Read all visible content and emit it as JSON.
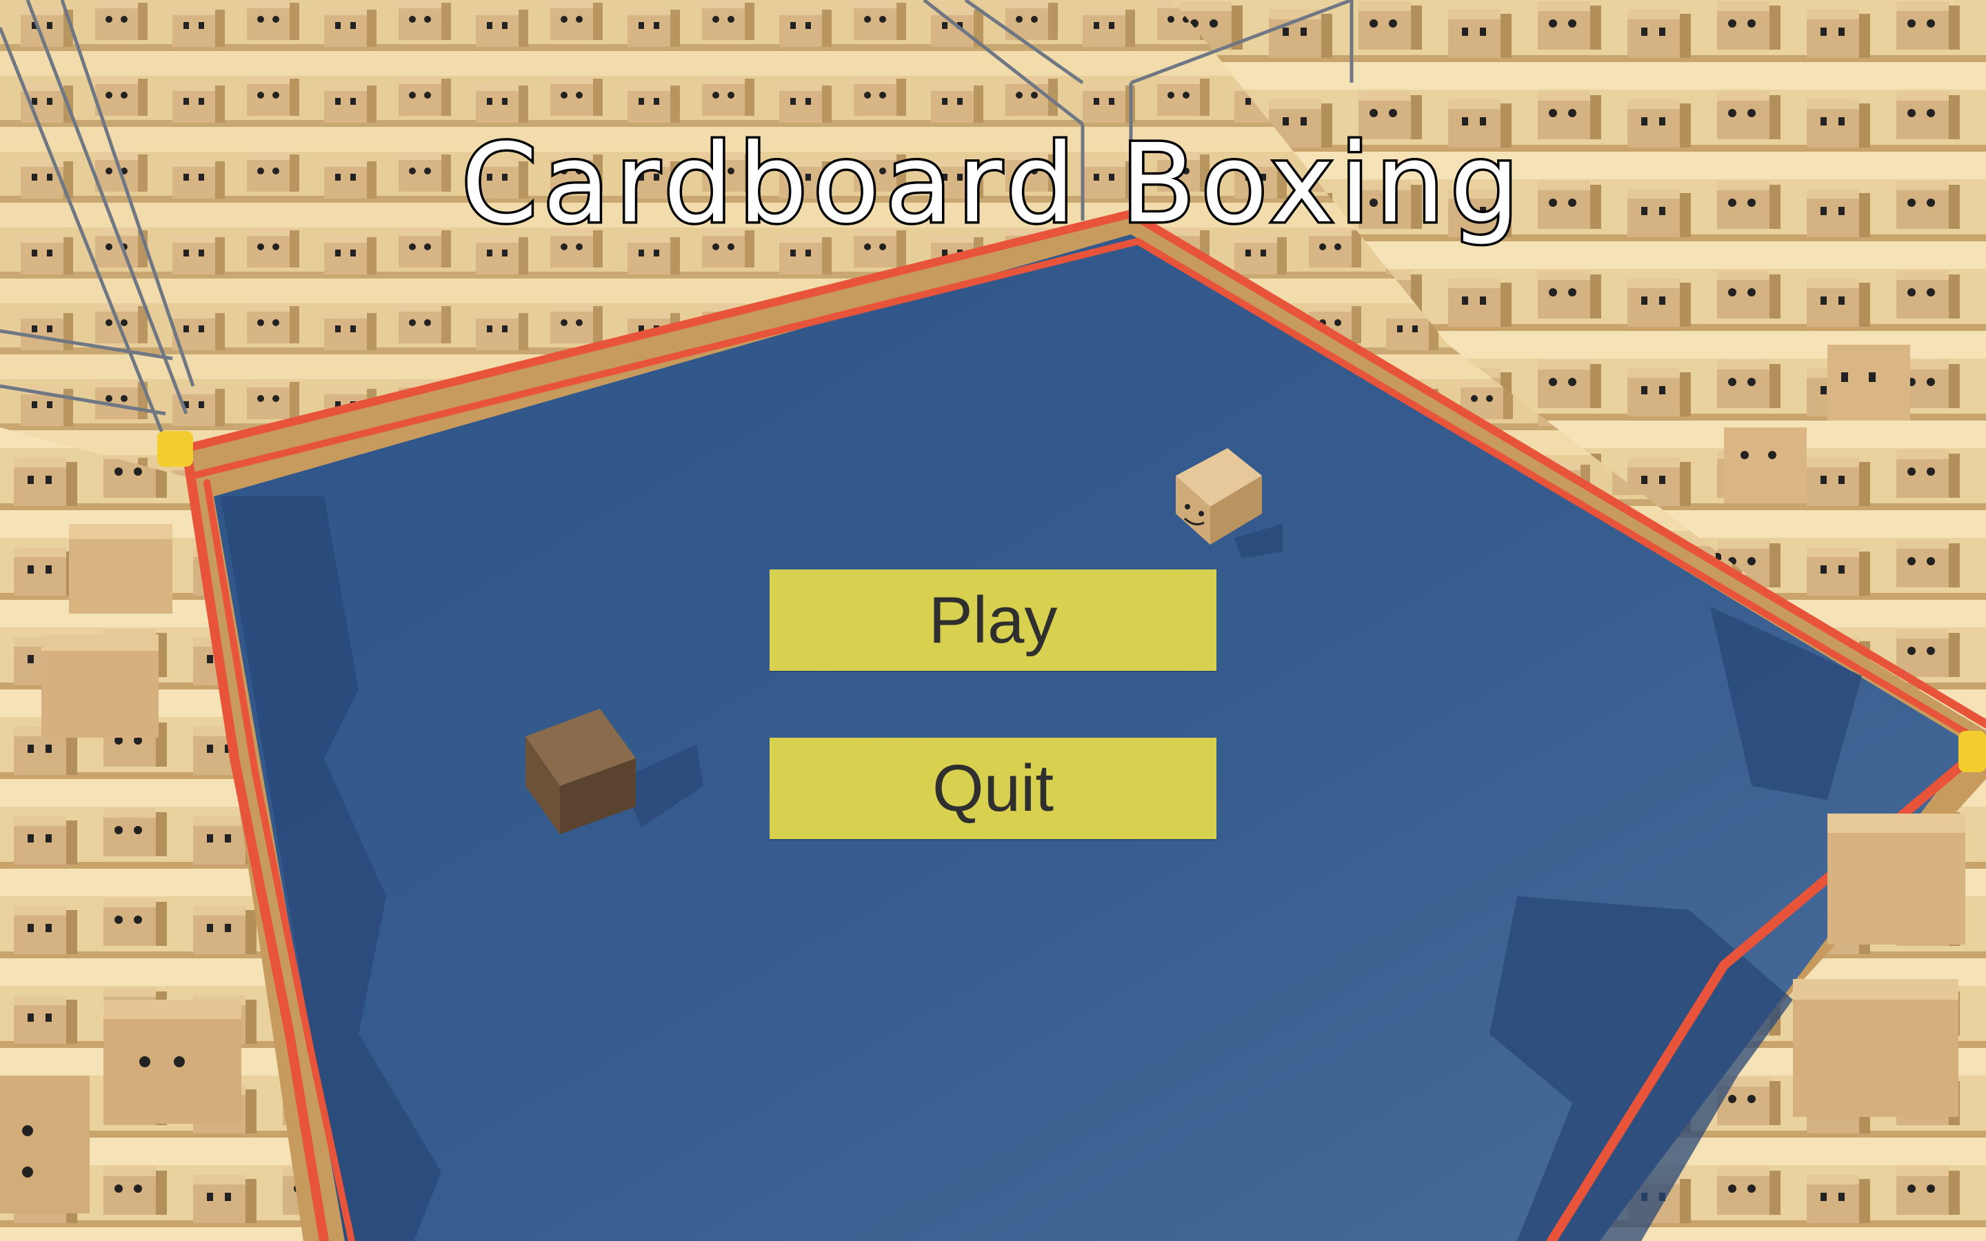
{
  "game": {
    "title": "Cardboard Boxing"
  },
  "menu": {
    "play_label": "Play",
    "quit_label": "Quit"
  },
  "colors": {
    "button_bg": "#d8d14f",
    "ring_mat": "#355a8c",
    "ring_rope": "#e8543a",
    "cardboard": "#d9b98a"
  }
}
